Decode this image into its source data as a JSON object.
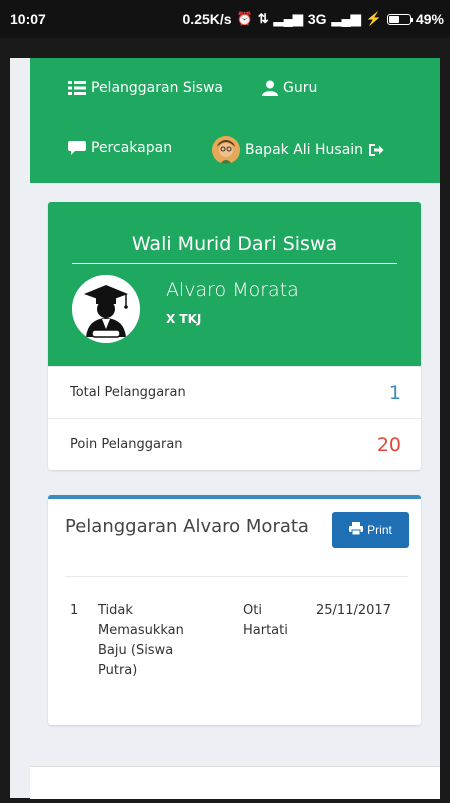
{
  "status_bar": {
    "time": "10:07",
    "network_speed": "0.25K/s",
    "network_type": "3G",
    "battery": "49%",
    "battery_level": 0.49
  },
  "navbar": {
    "items": [
      {
        "label": "Pelanggaran Siswa",
        "icon": "list-icon"
      },
      {
        "label": "Guru",
        "icon": "user-icon"
      },
      {
        "label": "Percakapan",
        "icon": "comment-icon"
      },
      {
        "label": "Bapak Ali Husain",
        "icon": "logout-icon"
      }
    ]
  },
  "profile": {
    "title": "Wali Murid Dari Siswa",
    "student_name": "Alvaro Morata",
    "class": "X TKJ",
    "stats": [
      {
        "label": "Total Pelanggaran",
        "value": "1",
        "color": "#3c8dbc"
      },
      {
        "label": "Poin Pelanggaran",
        "value": "20",
        "color": "#dd4b39"
      }
    ]
  },
  "violations": {
    "title": "Pelanggaran Alvaro Morata",
    "print_label": "Print",
    "rows": [
      {
        "no": "1",
        "description_lines": [
          "Tidak",
          "Memasukkan",
          "Baju (Siswa",
          "Putra)"
        ],
        "teacher_lines": [
          "Oti",
          "Hartati"
        ],
        "date": "25/11/2017"
      }
    ]
  },
  "colors": {
    "primary_green": "#1fa85f",
    "print_button": "#1f6fb5",
    "card_border_top": "#3c8dbc",
    "background": "#ecf0f5"
  }
}
